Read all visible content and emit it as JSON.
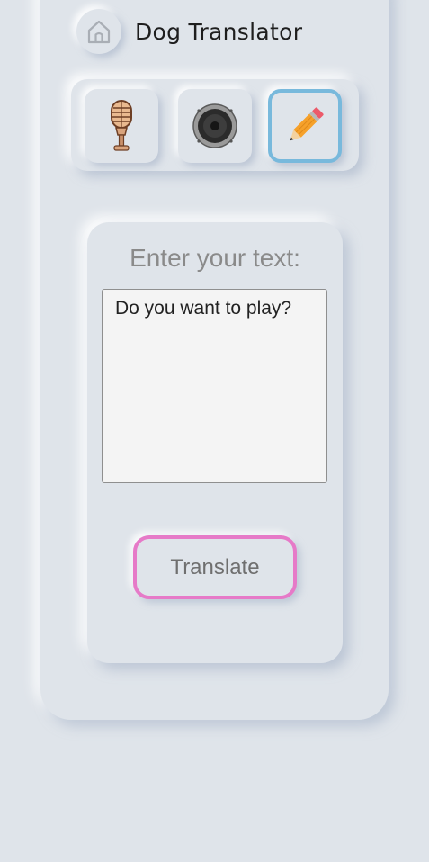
{
  "header": {
    "title": "Dog Translator",
    "home_icon": "home-icon"
  },
  "modes": [
    {
      "name": "microphone",
      "icon": "microphone-icon",
      "active": false
    },
    {
      "name": "speaker",
      "icon": "speaker-icon",
      "active": false
    },
    {
      "name": "text",
      "icon": "pencil-icon",
      "active": true
    }
  ],
  "panel": {
    "prompt_label": "Enter your text:",
    "input_value": "Do you want to play?",
    "translate_label": "Translate"
  },
  "colors": {
    "background": "#dfe4ea",
    "active_mode_border": "#78b9dc",
    "translate_border": "#e67ac8"
  }
}
